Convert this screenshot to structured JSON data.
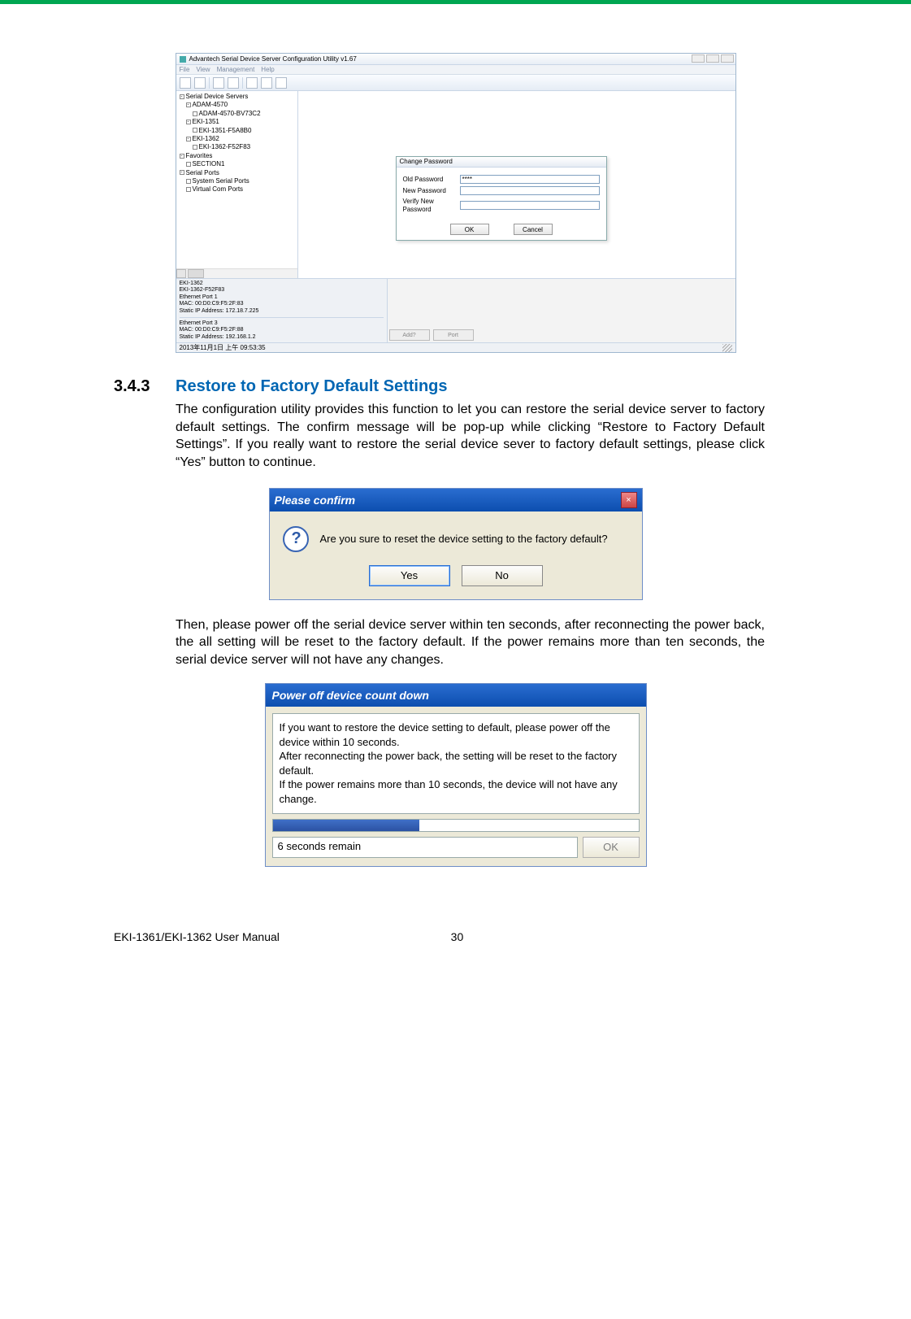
{
  "page": {
    "footer_left": "EKI-1361/EKI-1362 User Manual",
    "footer_page": "30"
  },
  "section": {
    "number": "3.4.3",
    "title": "Restore to Factory Default Settings",
    "para1": "The configuration utility provides this function to let you can restore the serial device server to factory default settings. The confirm message will be pop-up while clicking “Restore to Factory Default Settings”. If you really want to restore the serial device sever to factory default settings, please click “Yes” button to continue.",
    "para2": "Then, please power off the serial device server within ten seconds, after reconnecting the power back, the all setting will be reset to the factory default. If the power remains more than ten seconds, the serial device server will not have any changes."
  },
  "app": {
    "title": "Advantech Serial Device Server Configuration Utility v1.67",
    "menu": [
      "File",
      "View",
      "Management",
      "Help"
    ],
    "tree": {
      "root1": "Serial Device Servers",
      "items": [
        "ADAM-4570",
        "ADAM-4570-BV73C2",
        "EKI-1351",
        "EKI-1351-F5A8B0",
        "EKI-1362",
        "EKI-1362-F52F83"
      ],
      "root2": "Favorites",
      "fav1": "SECTION1",
      "root3": "Serial Ports",
      "sp1": "System Serial Ports",
      "sp2": "Virtual Com Ports"
    },
    "dialog": {
      "title": "Change Password",
      "fields": {
        "old": "Old Password",
        "new": "New Password",
        "verify": "Verify New Password"
      },
      "old_value": "****",
      "ok": "OK",
      "cancel": "Cancel"
    },
    "info": {
      "l1": "EKI-1362",
      "l2": "EKI-1362-F52F83",
      "l3": "Ethernet Port 1",
      "l4": "MAC: 00:D0:C9:F5:2F:83",
      "l5": "Static IP Address: 172.18.7.225",
      "l6": "Ethernet Port 3",
      "l7": "MAC: 00:D0:C9:F5:2F:88",
      "l8": "Static IP Address: 192.168.1.2"
    },
    "footer_button1": "Add?",
    "footer_button2": "Port",
    "status_left": "2013年11月1日 上午 09:53:35"
  },
  "confirm": {
    "title": "Please confirm",
    "message": "Are you sure to reset the device setting to the factory default?",
    "yes": "Yes",
    "no": "No"
  },
  "countdown": {
    "title": "Power off device count down",
    "message": "If you want to restore the device setting to default, please power off the device within 10 seconds.\nAfter reconnecting the power back, the setting will be reset to the factory default.\nIf the power remains more than 10 seconds, the device will not have any change.",
    "remain": "6 seconds remain",
    "ok": "OK"
  }
}
